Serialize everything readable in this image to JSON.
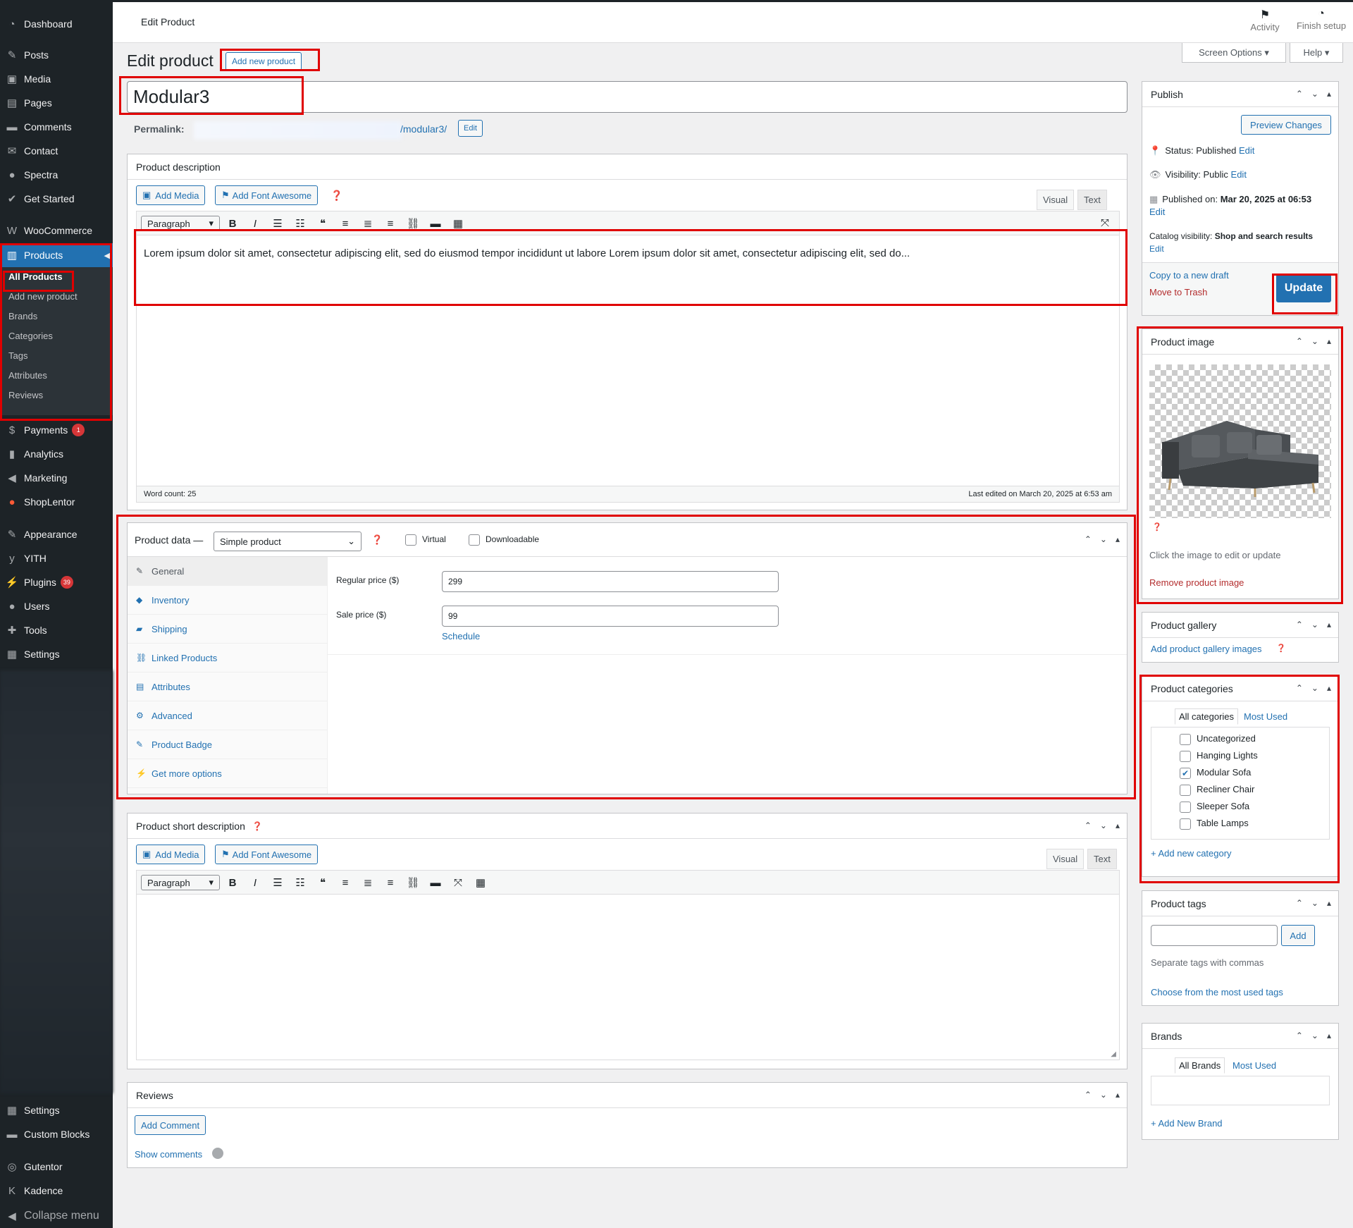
{
  "page": {
    "title": "Edit Product",
    "heading": "Edit product",
    "add_new": "Add new product"
  },
  "topbar": {
    "activity": "Activity",
    "finish_setup": "Finish setup",
    "screen_options": "Screen Options",
    "help": "Help"
  },
  "menu": {
    "dashboard": "Dashboard",
    "posts": "Posts",
    "media": "Media",
    "pages": "Pages",
    "comments": "Comments",
    "contact": "Contact",
    "spectra": "Spectra",
    "get_started": "Get Started",
    "woocommerce": "WooCommerce",
    "products": "Products",
    "products_sub": [
      "All Products",
      "Add new product",
      "Brands",
      "Categories",
      "Tags",
      "Attributes",
      "Reviews"
    ],
    "payments": "Payments",
    "payments_badge": "1",
    "analytics": "Analytics",
    "marketing": "Marketing",
    "shoplentor": "ShopLentor",
    "appearance": "Appearance",
    "yith": "YITH",
    "plugins": "Plugins",
    "plugins_badge": "39",
    "users": "Users",
    "tools": "Tools",
    "settings": "Settings",
    "settings2": "Settings",
    "custom_blocks": "Custom Blocks",
    "gutentor": "Gutentor",
    "kadence": "Kadence",
    "collapse": "Collapse menu"
  },
  "product": {
    "title": "Modular3",
    "permalink_label": "Permalink:",
    "permalink_slug": "/modular3/",
    "permalink_edit": "Edit"
  },
  "description": {
    "heading": "Product description",
    "add_media": "Add Media",
    "add_font_awesome": "Add Font Awesome",
    "tab_visual": "Visual",
    "tab_text": "Text",
    "format": "Paragraph",
    "content": "Lorem ipsum dolor sit amet, consectetur adipiscing elit, sed do eiusmod tempor incididunt ut labore Lorem ipsum dolor sit amet, consectetur adipiscing elit, sed do...",
    "word_count": "Word count: 25",
    "last_edited": "Last edited on March 20, 2025 at 6:53 am"
  },
  "product_data": {
    "label": "Product data —",
    "type": "Simple product",
    "virtual": "Virtual",
    "downloadable": "Downloadable",
    "tabs": [
      "General",
      "Inventory",
      "Shipping",
      "Linked Products",
      "Attributes",
      "Advanced",
      "Product Badge",
      "Get more options"
    ],
    "regular_price_label": "Regular price ($)",
    "regular_price": "299",
    "sale_price_label": "Sale price ($)",
    "sale_price": "99",
    "schedule": "Schedule"
  },
  "short_description": {
    "heading": "Product short description",
    "add_media": "Add Media",
    "add_font_awesome": "Add Font Awesome",
    "tab_visual": "Visual",
    "tab_text": "Text",
    "format": "Paragraph"
  },
  "reviews": {
    "heading": "Reviews",
    "add_comment": "Add Comment",
    "show_comments": "Show comments"
  },
  "publish": {
    "heading": "Publish",
    "preview": "Preview Changes",
    "status_label": "Status:",
    "status_value": "Published",
    "visibility_label": "Visibility:",
    "visibility_value": "Public",
    "published_label": "Published on:",
    "published_value": "Mar 20, 2025 at 06:53",
    "catalog_label": "Catalog visibility:",
    "catalog_value": "Shop and search results",
    "edit": "Edit",
    "copy_draft": "Copy to a new draft",
    "trash": "Move to Trash",
    "update": "Update"
  },
  "product_image": {
    "heading": "Product image",
    "hint": "Click the image to edit or update",
    "remove": "Remove product image"
  },
  "gallery": {
    "heading": "Product gallery",
    "add": "Add product gallery images"
  },
  "categories": {
    "heading": "Product categories",
    "tab_all": "All categories",
    "tab_most": "Most Used",
    "items": [
      {
        "name": "Uncategorized",
        "checked": false
      },
      {
        "name": "Hanging Lights",
        "checked": false
      },
      {
        "name": "Modular Sofa",
        "checked": true
      },
      {
        "name": "Recliner Chair",
        "checked": false
      },
      {
        "name": "Sleeper Sofa",
        "checked": false
      },
      {
        "name": "Table Lamps",
        "checked": false
      }
    ],
    "add_new": "+ Add new category"
  },
  "tags": {
    "heading": "Product tags",
    "add": "Add",
    "hint": "Separate tags with commas",
    "choose": "Choose from the most used tags"
  },
  "brands": {
    "heading": "Brands",
    "tab_all": "All Brands",
    "tab_most": "Most Used",
    "add_new": "+ Add New Brand"
  }
}
